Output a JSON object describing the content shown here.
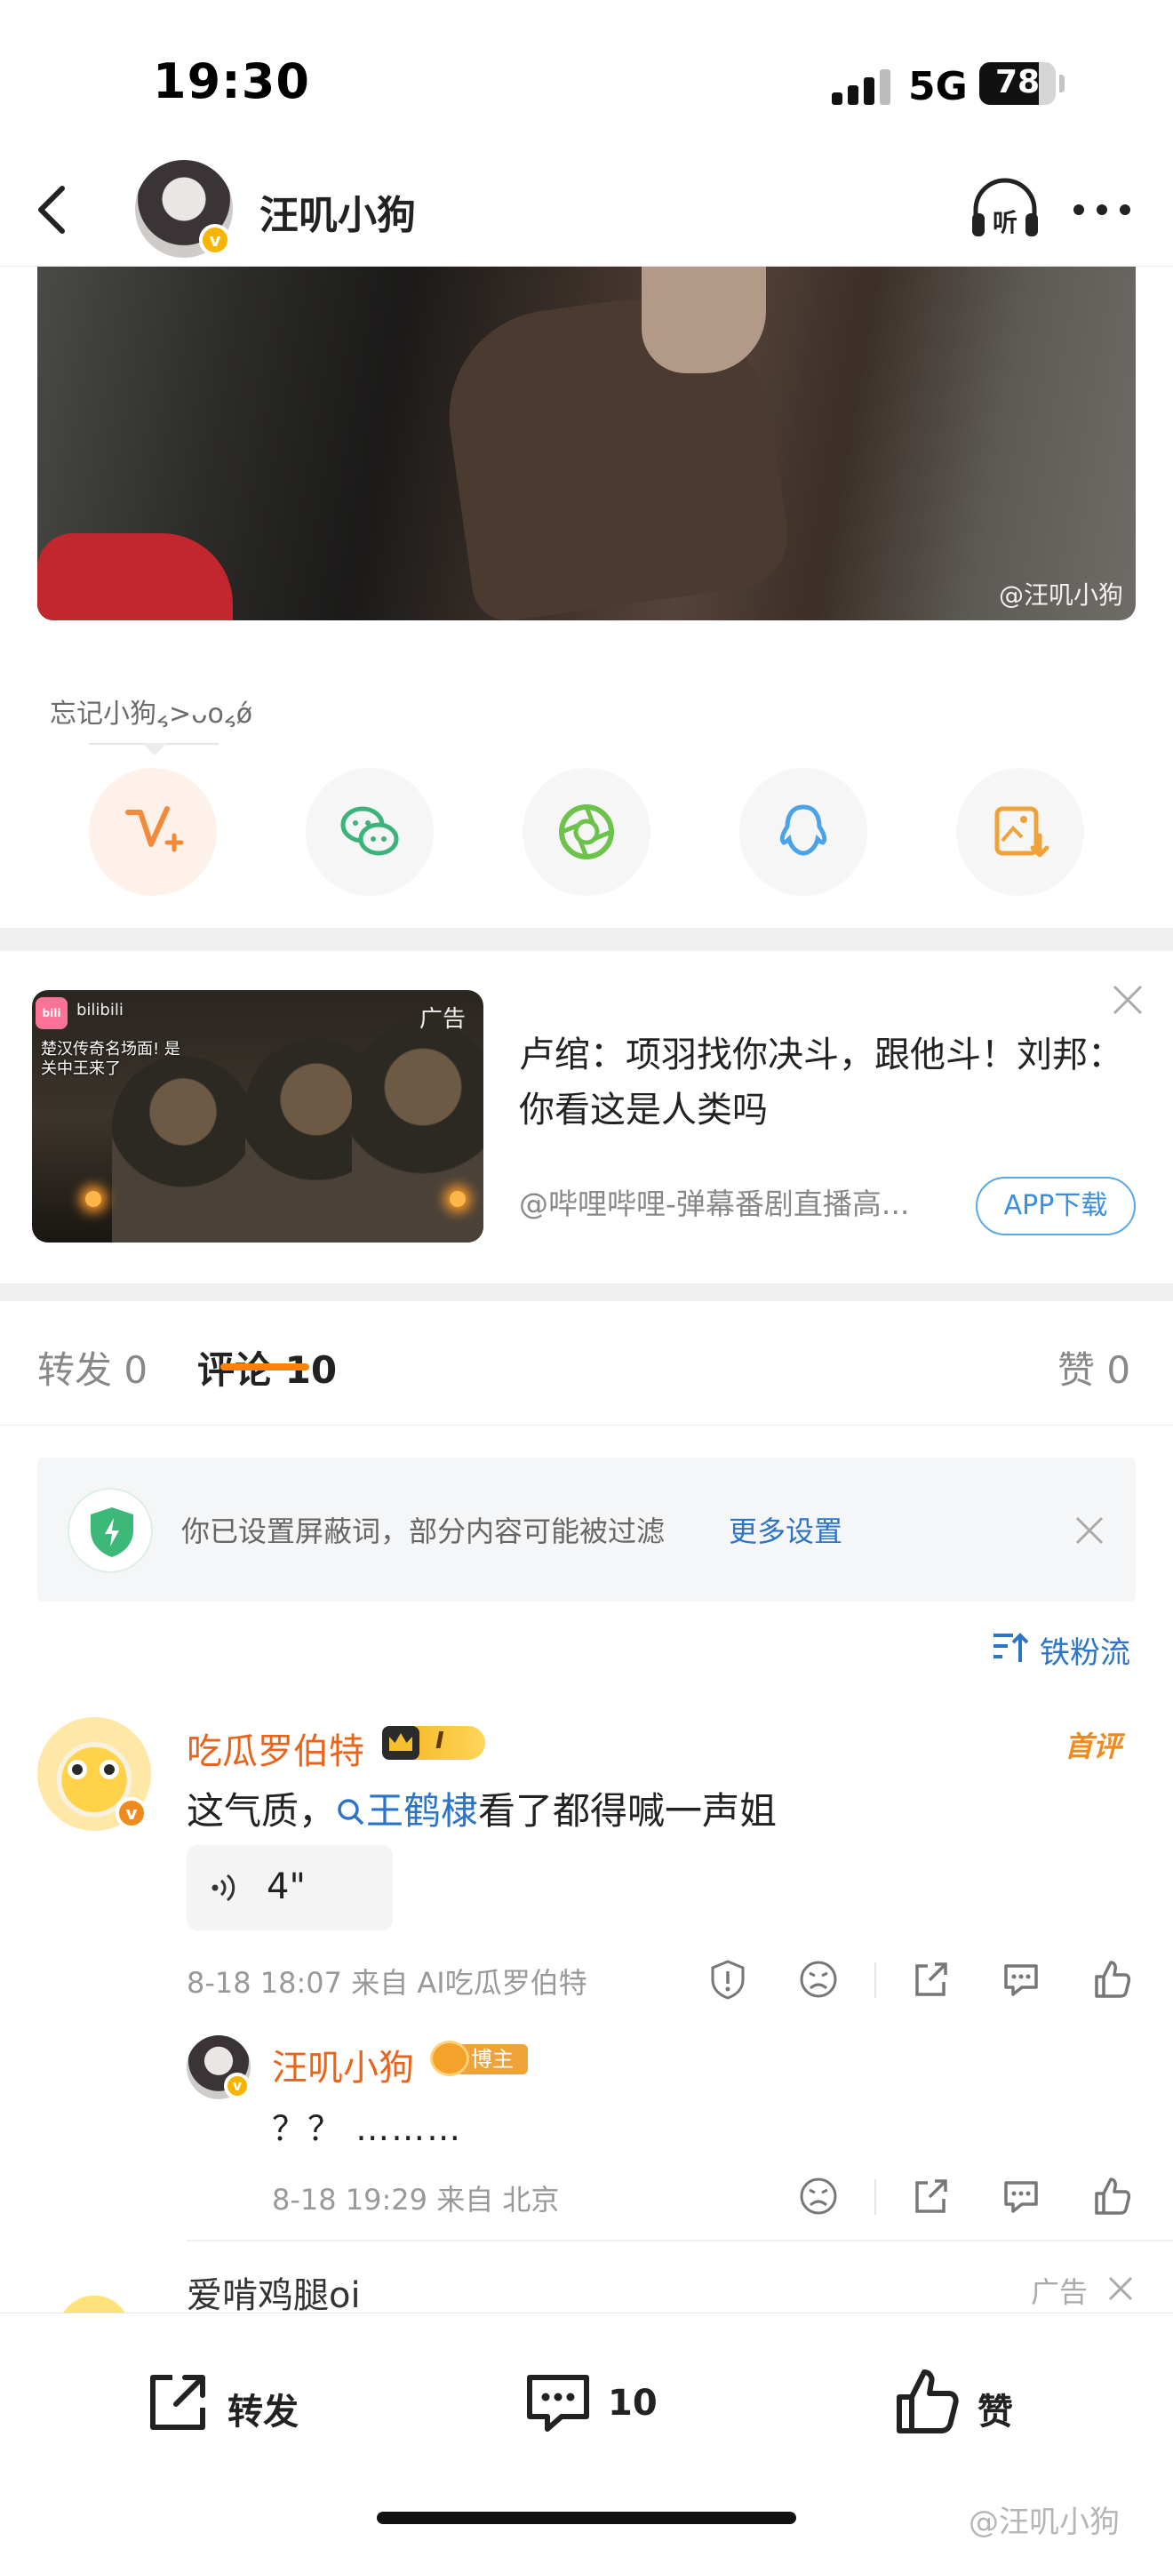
{
  "status_bar": {
    "time": "19:30",
    "network": "5G",
    "battery": "78",
    "battery_level": 0.78,
    "signal_bars": 3
  },
  "header": {
    "title": "汪叽小狗",
    "listen_label": "听"
  },
  "post": {
    "image_watermark": "@汪叽小狗"
  },
  "share": {
    "hint": "忘记小狗៹>ᴗo៹ǿ",
    "buttons": [
      "weibo-forward-icon",
      "wechat-icon",
      "moments-icon",
      "qq-icon",
      "save-image-icon"
    ]
  },
  "ad": {
    "tag": "广告",
    "thumb_logo": "bilibili",
    "thumb_caption": "楚汉传奇名场面! 是关中王来了",
    "title": "卢绾：项羽找你决斗，跟他斗！刘邦：你看这是人类吗",
    "source": "@哔哩哔哩-弹幕番剧直播高...",
    "download_label": "APP下载"
  },
  "tabs": [
    {
      "label": "转发 0"
    },
    {
      "label": "评论 10"
    },
    {
      "label": "赞 0"
    }
  ],
  "filter_notice": {
    "text": "你已设置屏蔽词，部分内容可能被过滤",
    "link": "更多设置"
  },
  "sort": {
    "label": "铁粉流"
  },
  "comment": {
    "author": "吃瓜罗伯特",
    "level": "I",
    "tag": "首评",
    "text_before": "这气质，",
    "topic": "王鹤棣",
    "text_after": "看了都得喊一声姐",
    "voice_duration": "4\"",
    "meta": "8-18 18:07  来自 AI吃瓜罗伯特",
    "reply": {
      "author": "汪叽小狗",
      "badge": "博主",
      "text": "？？ ………",
      "meta": "8-18 19:29  来自 北京"
    }
  },
  "next_comment": {
    "author": "爱啃鸡腿oi",
    "tag": "广告"
  },
  "bottom_bar": {
    "forward": "转发",
    "comments": "10",
    "like": "赞"
  },
  "bottom_watermark": "@汪叽小狗",
  "colors": {
    "accent": "#ff8200",
    "link": "#2b74c7",
    "name": "#e8641b",
    "verified": "#f7b500"
  }
}
